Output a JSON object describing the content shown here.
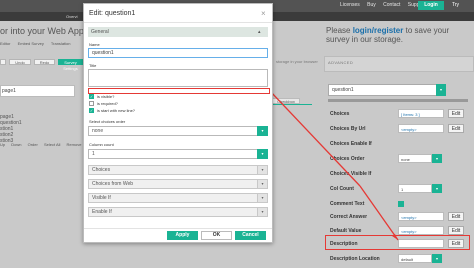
{
  "topbar": {
    "nav": [
      "LIBRARY",
      "CREATOR",
      "SERVICE"
    ],
    "links": [
      "Licenses",
      "Buy",
      "Contact",
      "Support"
    ],
    "login": "Login",
    "try_here": "Try",
    "tabs": [
      "Overvi"
    ],
    "tutorials": "Tutorials"
  },
  "left": {
    "heading": "or into your Web App?",
    "tabs": [
      "Editor",
      "Embed Survey",
      "Translation"
    ],
    "toolbar": [
      "",
      "Undo",
      "Redo",
      "Survey Settings"
    ],
    "page_select": "page1",
    "tree": [
      "page1",
      "question1",
      "stion1",
      "stion2",
      "stion3"
    ],
    "tree_actions": [
      "Up",
      "Down",
      "Order",
      "Select All",
      "Remove"
    ]
  },
  "notice": {
    "prefix": "Please ",
    "link": "login/register",
    "suffix": " to save your survey in our storage."
  },
  "canvas": {
    "note": "storage in your browser",
    "tab": "Checkbox"
  },
  "properties": {
    "header": "ADVANCED",
    "selected": "question1",
    "rows": [
      {
        "label": "Choices",
        "value": "[ Items: 3 ]",
        "kind": "edit"
      },
      {
        "label": "Choices By Url",
        "value": "<empty>",
        "kind": "edit"
      },
      {
        "label": "Choices Enable If",
        "value": "",
        "kind": "none"
      },
      {
        "label": "Choices Order",
        "value": "none",
        "kind": "select"
      },
      {
        "label": "Choices Visible If",
        "value": "",
        "kind": "none"
      },
      {
        "label": "Col Count",
        "value": "1",
        "kind": "select"
      },
      {
        "label": "Comment Text",
        "value": "",
        "kind": "none"
      },
      {
        "label": "Correct Answer",
        "value": "<empty>",
        "kind": "edit"
      },
      {
        "label": "Default Value",
        "value": "<empty>",
        "kind": "edit"
      },
      {
        "label": "Description",
        "value": "",
        "kind": "edit"
      },
      {
        "label": "Description Location",
        "value": "default",
        "kind": "select"
      }
    ],
    "edit_label": "Edit"
  },
  "modal": {
    "title": "Edit: question1",
    "close": "×",
    "section": "General",
    "name_label": "Name",
    "name_value": "question1",
    "title_label": "Title",
    "title_value": "",
    "checkboxes": [
      {
        "label": "is visible?",
        "checked": true
      },
      {
        "label": "is required?",
        "checked": false
      },
      {
        "label": "is start with new line?",
        "checked": true
      }
    ],
    "choices_order_label": "Select choices order",
    "choices_order_value": "none",
    "col_count_label": "Column count",
    "col_count_value": "1",
    "sections": [
      "Choices",
      "Choices from Web",
      "Visible If",
      "Enable If"
    ],
    "apply": "Apply",
    "ok": "OK",
    "cancel": "Cancel"
  },
  "colors": {
    "accent": "#1ab394",
    "highlight": "#e53935",
    "dark": "#535353"
  }
}
